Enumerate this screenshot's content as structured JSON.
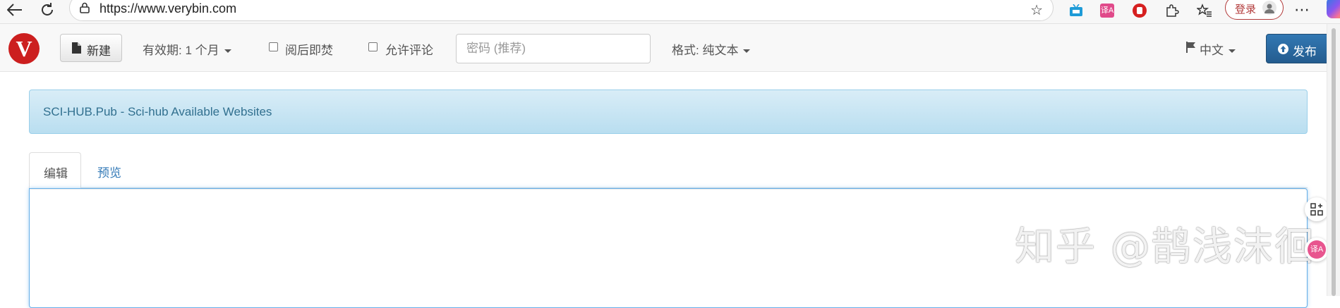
{
  "browser": {
    "url": "https://www.verybin.com",
    "login_label": "登录",
    "extension_translate_label": "译A"
  },
  "navbar": {
    "logo_letter": "V",
    "new_label": "新建",
    "expiry_label": "有效期: 1 个月",
    "burn_label": "阅后即焚",
    "comments_label": "允许评论",
    "password_placeholder": "密码 (推荐)",
    "format_label": "格式: 纯文本",
    "language_label": "中文",
    "publish_label": "发布"
  },
  "alert": {
    "text": "SCI-HUB.Pub - Sci-hub Available Websites"
  },
  "tabs": [
    {
      "label": "编辑",
      "active": true
    },
    {
      "label": "预览",
      "active": false
    }
  ],
  "watermark": "知乎 @鹊浅沫徊",
  "float_translate_label": "译A"
}
